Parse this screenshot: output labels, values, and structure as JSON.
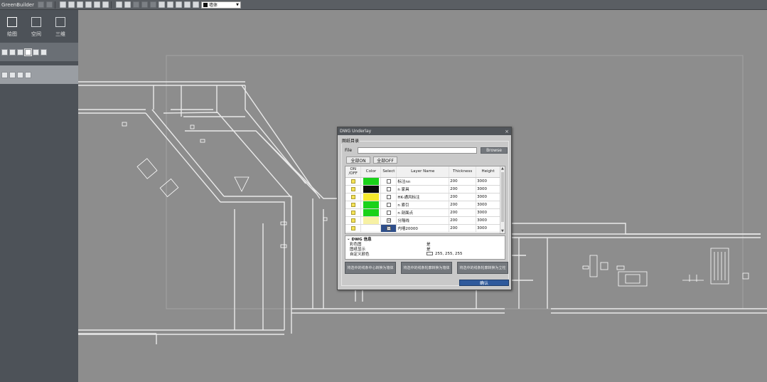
{
  "app": {
    "title": "GreenBuilder"
  },
  "toolbar": {
    "icons": [
      "undo-icon",
      "redo-icon",
      "new-file-icon",
      "open-icon",
      "save-icon",
      "print-icon",
      "export-icon",
      "select-icon",
      "pan-icon",
      "rotate-icon",
      "zoom-in-icon",
      "zoom-out-icon",
      "zoom-extents-icon",
      "grid-icon",
      "settings-icon",
      "list-icon",
      "bulb-icon"
    ],
    "layer_select": "墙体"
  },
  "sidebar": {
    "modes": [
      {
        "label": "绘图",
        "icon": "pencil-icon"
      },
      {
        "label": "空间",
        "icon": "space-icon"
      },
      {
        "label": "三维",
        "icon": "cube-icon"
      }
    ],
    "tool_row1": [
      "wall-tool-icon",
      "room-tool-icon",
      "door-tool-icon",
      "window-tool-icon",
      "column-tool-icon",
      "stair-tool-icon"
    ],
    "tool_row2": [
      "edit-tool-icon",
      "edit-tool-icon",
      "edit-tool-icon",
      "edit-tool-icon"
    ]
  },
  "dialog": {
    "title": "DWG Underlay",
    "close": "×",
    "group_label": "图纸目录",
    "file_label": "File",
    "file_value": "",
    "browse": "Browse",
    "all_on": "全部ON",
    "all_off": "全部OFF",
    "columns": [
      "ON /OFF",
      "Color",
      "Select",
      "Layer Name",
      "Thickness",
      "Height"
    ],
    "layers": [
      {
        "color": "#19d219",
        "checked": "",
        "name": "标注nn",
        "thickness": "200",
        "height": "3000",
        "selected": false
      },
      {
        "color": "#0b0b0b",
        "checked": "",
        "name": "n 家具",
        "thickness": "200",
        "height": "3000",
        "selected": false
      },
      {
        "color": "#f5e92c",
        "checked": "",
        "name": "HK-通风标注",
        "thickness": "200",
        "height": "3000",
        "selected": false
      },
      {
        "color": "#19d219",
        "checked": "",
        "name": "n 索引",
        "thickness": "200",
        "height": "3000",
        "selected": false
      },
      {
        "color": "#19d219",
        "checked": "",
        "name": "n 剖面点",
        "thickness": "200",
        "height": "3000",
        "selected": false
      },
      {
        "color": "#f7f1a4",
        "checked": "☑",
        "name": "分隔线",
        "thickness": "200",
        "height": "3000",
        "selected": false
      },
      {
        "color": "#ffffff",
        "checked": "☑",
        "name": "内墙20000",
        "thickness": "200",
        "height": "3000",
        "selected": true
      }
    ],
    "props": {
      "header": "DWG 信息",
      "rows": [
        {
          "key": "彩色图",
          "value": "是"
        },
        {
          "key": "图纸显示",
          "value": "是"
        },
        {
          "key": "自定义颜色",
          "value": "255, 255, 255"
        }
      ]
    },
    "actions": [
      "将选中的线条中心转换为墙体",
      "将选中的线条轮廓转换为墙体",
      "将选中的线条轮廓转换为立柱"
    ],
    "confirm": "确认"
  }
}
